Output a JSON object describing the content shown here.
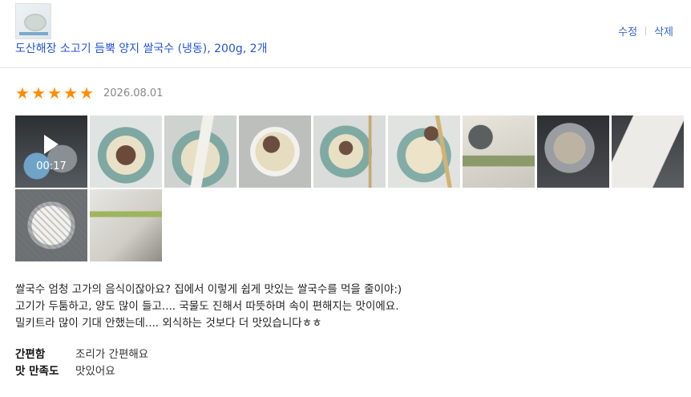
{
  "product": {
    "title": "도산해장 소고기 듬뿍 양지 쌀국수 (냉동), 200g, 2개",
    "thumbnail_icon": "product-thumbnail"
  },
  "actions": {
    "edit_label": "수정",
    "delete_label": "삭제"
  },
  "rating": {
    "stars": 5,
    "max_stars": 5,
    "date": "2026.08.01",
    "star_color": "#ff8c00"
  },
  "media": {
    "video": {
      "duration": "00:17"
    },
    "photos": [
      {
        "name": "photo-video-hands"
      },
      {
        "name": "photo-lifting-beef"
      },
      {
        "name": "photo-lifting-noodles"
      },
      {
        "name": "photo-bowl-top"
      },
      {
        "name": "photo-bowl-spoon"
      },
      {
        "name": "photo-bowl-gold-spoon"
      },
      {
        "name": "photo-package-and-bowl"
      },
      {
        "name": "photo-pot-cooking"
      },
      {
        "name": "photo-package-front"
      },
      {
        "name": "photo-strainer-noodles"
      },
      {
        "name": "photo-package-back"
      }
    ]
  },
  "review": {
    "lines": [
      "쌀국수 엄청 고가의 음식이잖아요? 집에서 이렇게 쉽게 맛있는 쌀국수를 먹을 줄이야:)",
      "고기가 두툼하고, 양도 많이 들고.... 국물도 진해서 따뜻하며 속이 편해지는 맛이에요.",
      "밀키트라 많이 기대 안했는데.... 외식하는 것보다 더 맛있습니다ㅎㅎ"
    ]
  },
  "attributes": [
    {
      "label": "간편함",
      "value": "조리가 간편해요"
    },
    {
      "label": "맛 만족도",
      "value": "맛있어요"
    }
  ],
  "colors": {
    "link": "#2355d4",
    "action": "#3366cc",
    "date": "#888888"
  }
}
